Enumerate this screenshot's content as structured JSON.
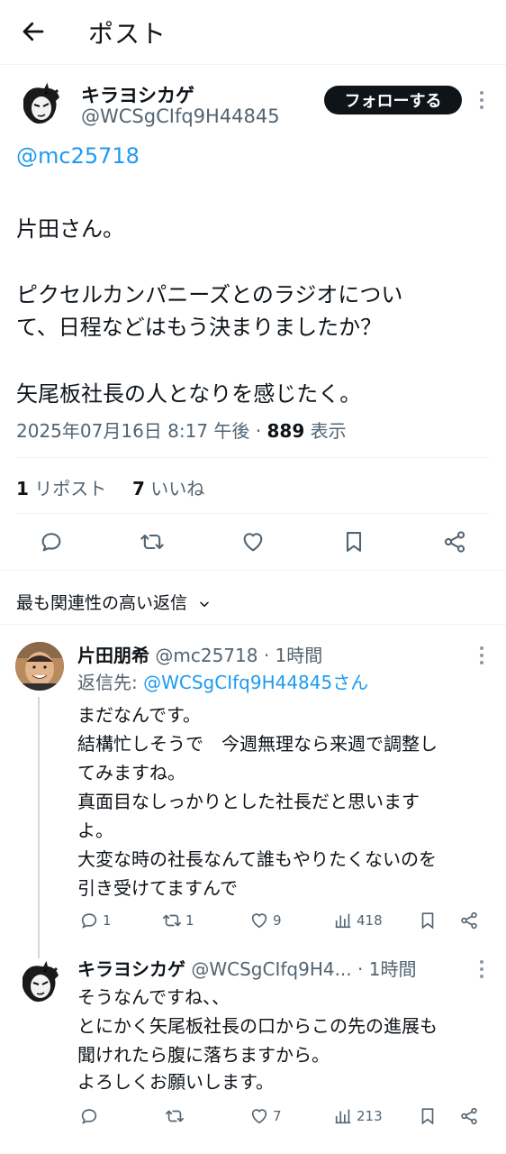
{
  "header": {
    "title": "ポスト"
  },
  "post": {
    "author_name": "キラヨシカゲ",
    "author_handle": "@WCSgCIfq9H44845",
    "follow_label": "フォローする",
    "mention": "@mc25718",
    "lines": [
      "片田さん。",
      "ピクセルカンパニーズとのラジオについ",
      "て、日程などはもう決まりましたか？",
      "矢尾板社長の人となりを感じたく。"
    ],
    "timestamp": "2025年07月16日 8:17 午後 · ",
    "views_count": "889",
    "views_label": " 表示",
    "reposts_count": "1",
    "reposts_label": " リポスト",
    "likes_count": "7",
    "likes_label": " いいね"
  },
  "actions": {
    "icons": [
      "reply-icon",
      "repost-icon",
      "like-icon",
      "bookmark-icon",
      "share-icon"
    ]
  },
  "sort": {
    "label": "最も関連性の高い返信"
  },
  "replies": [
    {
      "name": "片田朋希",
      "handle": "@mc25718 · 1時間",
      "reply_to_prefix": "返信先: ",
      "reply_to_handle": "@WCSgCIfq9H44845さん",
      "lines": [
        "まだなんです。",
        "結構忙しそうで　今週無理なら来週で調整し",
        "てみますね。",
        "真面目なしっかりとした社長だと思います",
        "よ。",
        "大変な時の社長なんて誰もやりたくないのを",
        "引き受けてますんで"
      ],
      "reply_count": "1",
      "repost_count": "1",
      "like_count": "9",
      "view_count": "418"
    },
    {
      "name": "キラヨシカゲ",
      "handle": "@WCSgCIfq9H4...",
      "time": " · 1時間",
      "lines": [
        "そうなんですね、、",
        "とにかく矢尾板社長の口からこの先の進展も",
        "聞けれたら腹に落ちますから。",
        "よろしくお願いします。"
      ],
      "reply_count": "",
      "repost_count": "",
      "like_count": "7",
      "view_count": "213"
    }
  ]
}
